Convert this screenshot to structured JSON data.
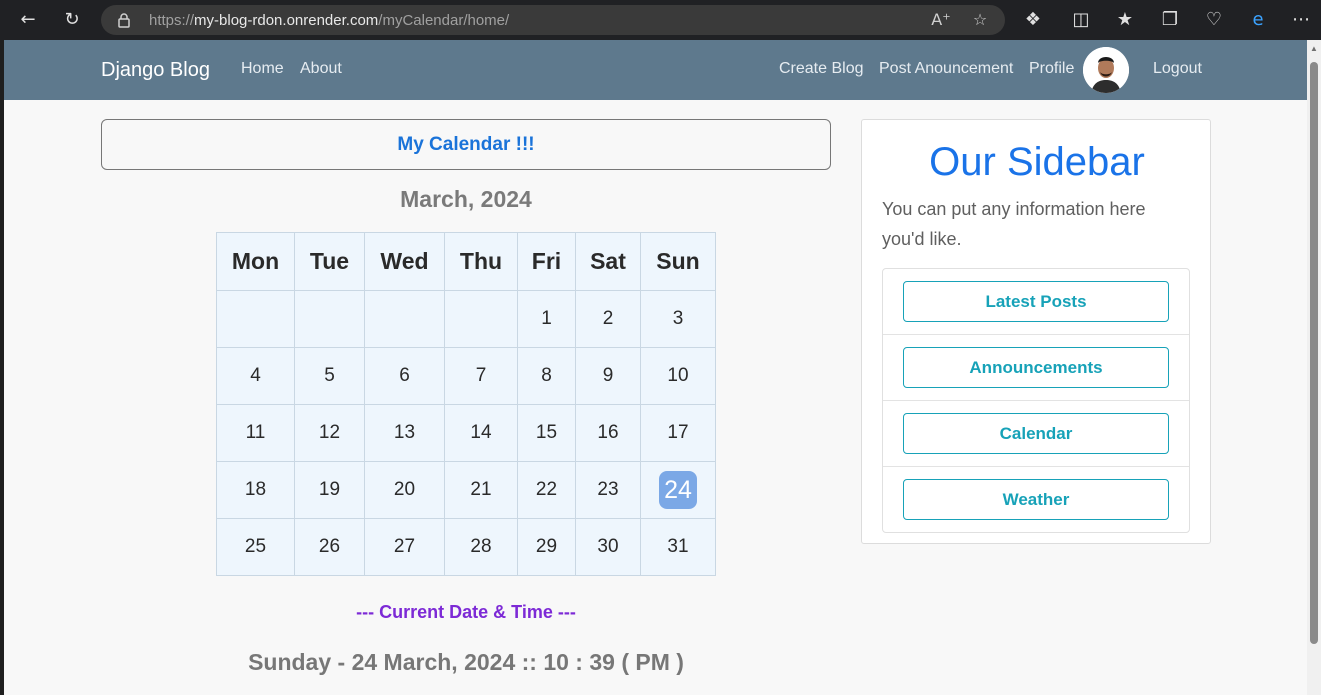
{
  "browser": {
    "url_prefix": "https://",
    "url_domain": "my-blog-rdon.onrender.com",
    "url_path": "/myCalendar/home/"
  },
  "navbar": {
    "brand": "Django Blog",
    "left_links": [
      "Home",
      "About"
    ],
    "right_links": [
      "Create Blog",
      "Post Anouncement",
      "Profile"
    ],
    "logout": "Logout"
  },
  "calendar": {
    "header": "My Calendar !!!",
    "month_title": "March, 2024",
    "weekdays": [
      "Mon",
      "Tue",
      "Wed",
      "Thu",
      "Fri",
      "Sat",
      "Sun"
    ],
    "weeks": [
      [
        "",
        "",
        "",
        "",
        "1",
        "2",
        "3"
      ],
      [
        "4",
        "5",
        "6",
        "7",
        "8",
        "9",
        "10"
      ],
      [
        "11",
        "12",
        "13",
        "14",
        "15",
        "16",
        "17"
      ],
      [
        "18",
        "19",
        "20",
        "21",
        "22",
        "23",
        "24"
      ],
      [
        "25",
        "26",
        "27",
        "28",
        "29",
        "30",
        "31"
      ]
    ],
    "today": "24",
    "datetime_label": "--- Current Date & Time ---",
    "datetime_value": "Sunday - 24 March, 2024 :: 10 : 39 ( PM )"
  },
  "sidebar": {
    "title": "Our Sidebar",
    "text": "You can put any information here you'd like.",
    "buttons": [
      "Latest Posts",
      "Announcements",
      "Calendar",
      "Weather"
    ]
  },
  "colors": {
    "navbar": "#5e798d",
    "accent_blue": "#1a73e8",
    "teal": "#17a2b8",
    "purple": "#7d2ad6",
    "today_bg": "#7ba8e6"
  }
}
